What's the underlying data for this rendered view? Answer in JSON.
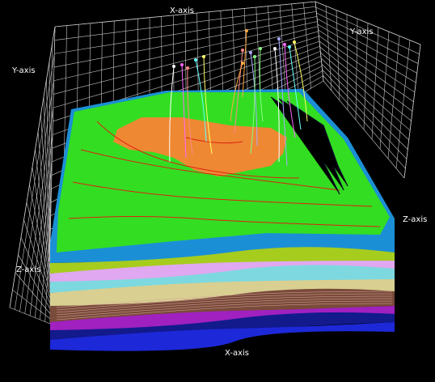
{
  "viewer": {
    "axis_labels": {
      "x_top": "X-axis",
      "y_right": "Y-axis",
      "y_left": "Y-axis",
      "z_right": "Z-axis",
      "z_left": "Z-axis",
      "x_bottom": "X-axis"
    },
    "colors": {
      "background": "#000000",
      "grid": "#c8c8c8",
      "terrain": "#33dd22",
      "orange_zone": "#ee8833",
      "contour": "#dd2211",
      "top_band": "#1b8fd6",
      "yellowgreen_band": "#a6cc1e",
      "lavender_band": "#e0a8f0",
      "cyan_band": "#7dd9df",
      "khaki_band": "#d8cf90",
      "brown_band": "#7a4a3a",
      "magenta_band": "#a020c0",
      "navy_band": "#121a8c",
      "blue_base": "#1d28d8"
    }
  }
}
